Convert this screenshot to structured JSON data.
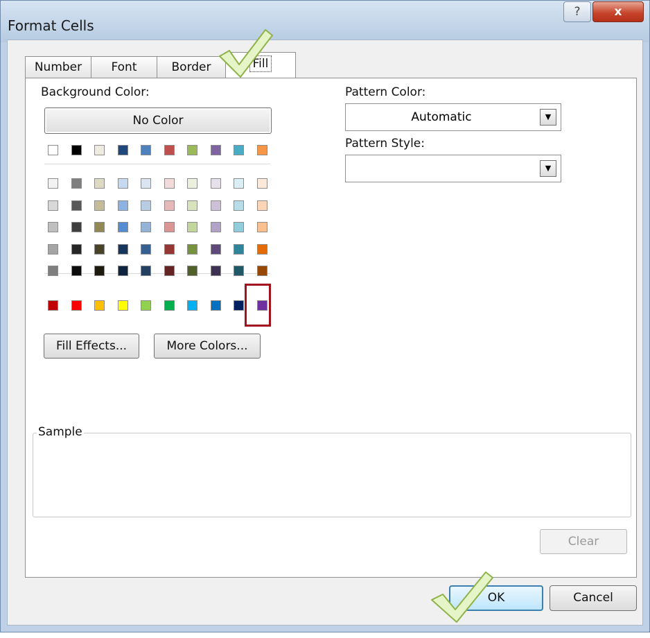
{
  "window": {
    "title": "Format Cells",
    "help_label": "?",
    "close_label": "x"
  },
  "tabs": [
    {
      "label": "Number"
    },
    {
      "label": "Font"
    },
    {
      "label": "Border"
    },
    {
      "label": "Fill",
      "active": true
    }
  ],
  "background": {
    "label": "Background Color:",
    "no_color_label": "No Color",
    "theme_colors": [
      "#ffffff",
      "#000000",
      "#eeece1",
      "#1f497d",
      "#4f81bd",
      "#c0504d",
      "#9bbb59",
      "#8064a2",
      "#4bacc6",
      "#f79646"
    ],
    "tint_rows": [
      [
        "#f2f2f2",
        "#7f7f7f",
        "#ddd9c3",
        "#c6d9f0",
        "#dbe5f1",
        "#f2dcdb",
        "#ebf1dd",
        "#e5e0ec",
        "#dbeef3",
        "#fdeada"
      ],
      [
        "#d8d8d8",
        "#595959",
        "#c4bd97",
        "#8db3e2",
        "#b8cce4",
        "#e5b9b7",
        "#d7e3bc",
        "#ccc1d9",
        "#b7dde8",
        "#fbd5b5"
      ],
      [
        "#bfbfbf",
        "#3f3f3f",
        "#938953",
        "#548dd4",
        "#95b3d7",
        "#d99694",
        "#c3d69b",
        "#b2a2c7",
        "#92cddc",
        "#fac08f"
      ],
      [
        "#a5a5a5",
        "#262626",
        "#494429",
        "#17365d",
        "#366092",
        "#953734",
        "#76923c",
        "#5f497a",
        "#31859b",
        "#e36c09"
      ],
      [
        "#7f7f7f",
        "#0c0c0c",
        "#1d1b10",
        "#0f243e",
        "#244061",
        "#632423",
        "#4f6128",
        "#3f3151",
        "#205867",
        "#974806"
      ]
    ],
    "standard_colors": [
      "#c00000",
      "#ff0000",
      "#ffc000",
      "#ffff00",
      "#92d050",
      "#00b050",
      "#00b0f0",
      "#0070c0",
      "#002060",
      "#7030a0"
    ],
    "selected_color": "#7030a0"
  },
  "buttons": {
    "fill_effects": "Fill Effects...",
    "more_colors": "More Colors...",
    "clear": "Clear",
    "ok": "OK",
    "cancel": "Cancel"
  },
  "pattern": {
    "color_label": "Pattern Color:",
    "color_value": "Automatic",
    "style_label": "Pattern Style:",
    "style_value": ""
  },
  "sample": {
    "label": "Sample"
  }
}
